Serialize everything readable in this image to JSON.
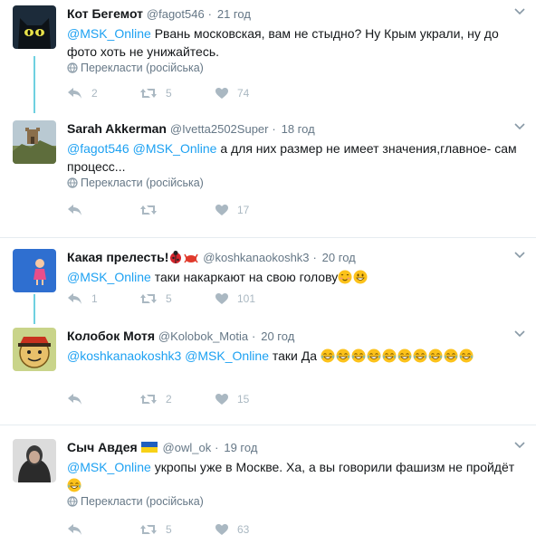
{
  "colors": {
    "link": "#1da1f2",
    "muted": "#657786",
    "icon": "#aab8c2",
    "thread": "#6ed0e0",
    "divider": "#e6ecf0"
  },
  "translate_label": "Перекласти (російська)",
  "tweets": [
    {
      "name": "Кот Бегемот",
      "handle": "@fagot546",
      "time": "21 год",
      "mentions": [
        "@MSK_Online"
      ],
      "text": "Рвань московская, вам не стыдно? Ну Крым украли, ну до фото хоть не унижайтесь.",
      "replies": "2",
      "retweets": "5",
      "likes": "74",
      "avatar_icon": "black-cat-avatar"
    },
    {
      "name": "Sarah Akkerman",
      "handle": "@Ivetta2502Super",
      "time": "18 год",
      "mentions": [
        "@fagot546",
        "@MSK_Online"
      ],
      "text": "а для них размер не имеет значения,главное- сам процесс...",
      "replies": "",
      "retweets": "",
      "likes": "17",
      "avatar_icon": "castle-landscape-avatar"
    },
    {
      "name": "Какая прелесть!",
      "handle": "@koshkanaokoshk3",
      "time": "20 год",
      "mentions": [
        "@MSK_Online"
      ],
      "text": "таки накаркают на свою голову",
      "replies": "1",
      "retweets": "5",
      "likes": "101",
      "avatar_icon": "cartoon-girl-moon-avatar"
    },
    {
      "name": "Колобок Мотя",
      "handle": "@Kolobok_Motia",
      "time": "20 год",
      "mentions": [
        "@koshkanaokoshk3",
        "@MSK_Online"
      ],
      "text": "таки Да",
      "replies": "",
      "retweets": "2",
      "likes": "15",
      "avatar_icon": "cartoon-kolobok-avatar"
    },
    {
      "name": "Сыч Авдея",
      "handle": "@owl_ok",
      "time": "19 год",
      "mentions": [
        "@MSK_Online"
      ],
      "text": "укропы уже в Москве. Ха, а вы говорили фашизм не пройдёт",
      "replies": "",
      "retweets": "5",
      "likes": "63",
      "avatar_icon": "man-hoodie-avatar"
    }
  ]
}
